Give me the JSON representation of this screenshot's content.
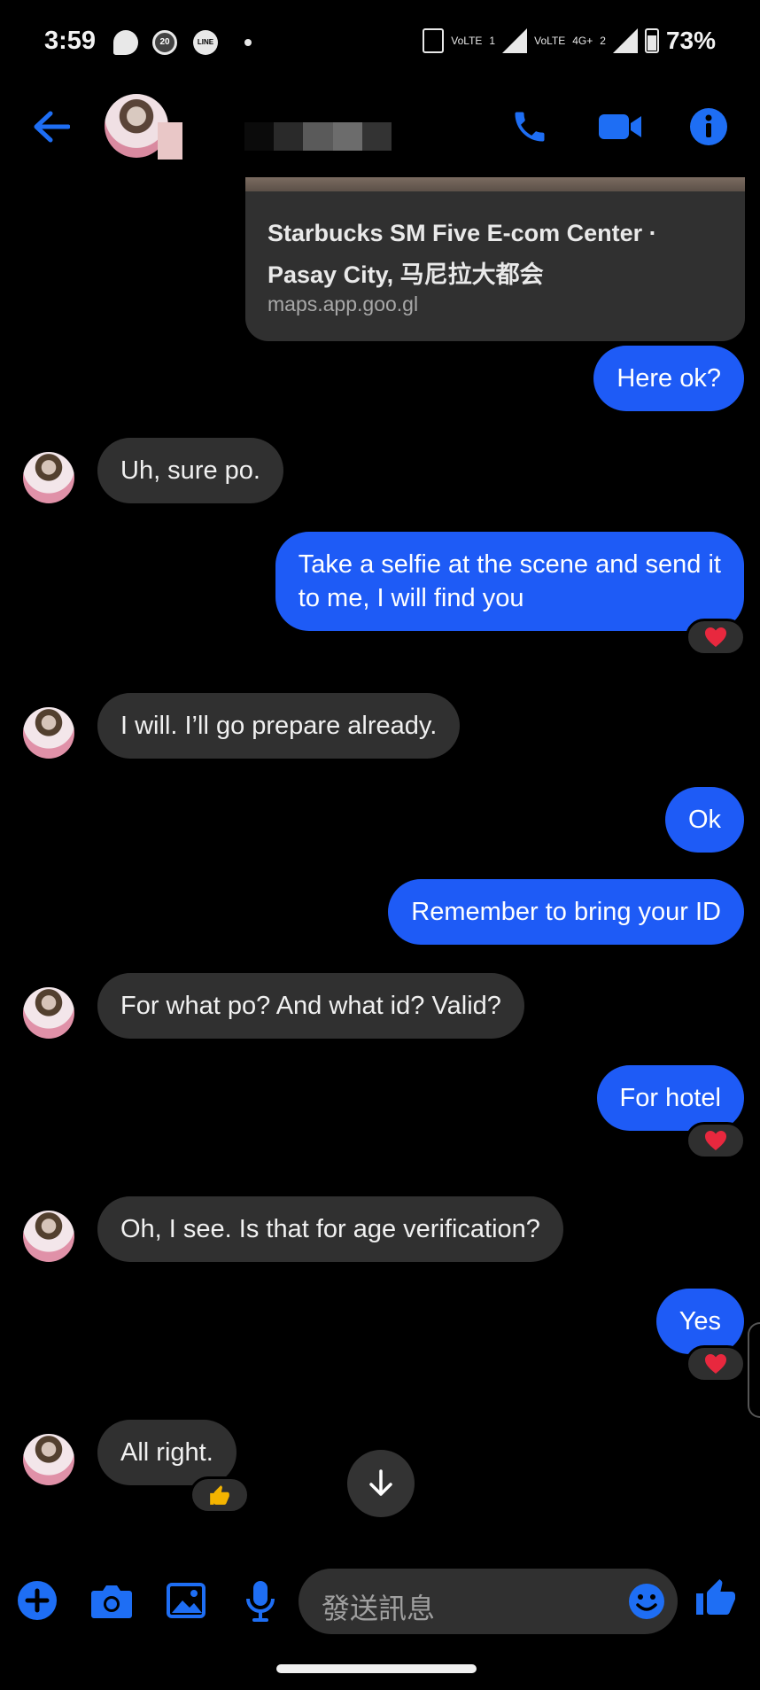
{
  "status_bar": {
    "time": "3:59",
    "notif_2": "20",
    "notif_3": "LINE",
    "volte1": "VoLTE",
    "sim1": "1",
    "volte2": "VoLTE",
    "net": "4G+",
    "sim2": "2",
    "battery": "73%"
  },
  "header": {
    "accent": "#1e6ef4"
  },
  "link_card": {
    "title_line1": "Starbucks SM Five E-com Center ·",
    "title_line2": "Pasay City, 马尼拉大都会",
    "url": "maps.app.goo.gl"
  },
  "messages": [
    {
      "dir": "out",
      "text": "Here ok?"
    },
    {
      "dir": "in",
      "text": "Uh, sure po."
    },
    {
      "dir": "out",
      "lines": [
        "Take a selfie at the scene and send it",
        "to me, I will find you"
      ],
      "reaction": "heart"
    },
    {
      "dir": "in",
      "text": "I will. I’ll go prepare already."
    },
    {
      "dir": "out",
      "text": "Ok"
    },
    {
      "dir": "out",
      "text": "Remember to bring your ID"
    },
    {
      "dir": "in",
      "text": "For what po? And what id? Valid?"
    },
    {
      "dir": "out",
      "text": "For hotel",
      "reaction": "heart"
    },
    {
      "dir": "in",
      "text": "Oh, I see. Is that for age verification?"
    },
    {
      "dir": "out",
      "text": "Yes",
      "reaction": "heart"
    },
    {
      "dir": "in",
      "text": "All right.",
      "reaction": "thumbs-up"
    }
  ],
  "composer": {
    "placeholder": "發送訊息"
  },
  "colors": {
    "outgoing_bubble": "#1e5bf6",
    "incoming_bubble": "#303030",
    "heart": "#e8283e",
    "thumb": "#f4b400"
  }
}
